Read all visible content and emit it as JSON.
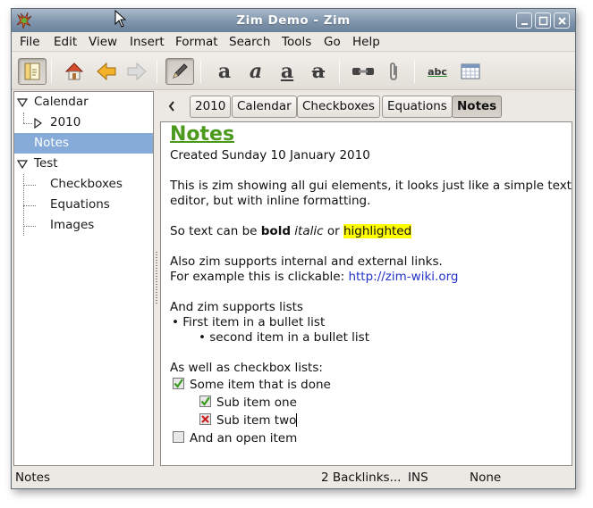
{
  "window": {
    "title": "Zim Demo - Zim",
    "controls": [
      "minimize-icon",
      "maximize-icon",
      "close-icon"
    ]
  },
  "menubar": {
    "items": [
      "File",
      "Edit",
      "View",
      "Insert",
      "Format",
      "Search",
      "Tools",
      "Go",
      "Help"
    ]
  },
  "toolbar": {
    "icons": [
      "index-pane-icon",
      "home-icon",
      "back-arrow-icon",
      "forward-arrow-icon",
      "edit-pencil-icon",
      "bold-icon",
      "italic-icon",
      "underline-icon",
      "strikethrough-icon",
      "insert-link-icon",
      "attach-file-icon",
      "spell-check-icon",
      "calendar-icon"
    ],
    "bold_glyph": "a",
    "italic_glyph": "a",
    "underline_glyph": "a",
    "strike_glyph": "a",
    "spell_glyph": "abc"
  },
  "sidebar": {
    "items": [
      {
        "label": "Calendar",
        "expanded": true,
        "level": 0
      },
      {
        "label": "2010",
        "expanded": false,
        "level": 1
      },
      {
        "label": "Notes",
        "selected": true,
        "level": 0
      },
      {
        "label": "Test",
        "expanded": true,
        "level": 0
      },
      {
        "label": "Checkboxes",
        "level": 1
      },
      {
        "label": "Equations",
        "level": 1
      },
      {
        "label": "Images",
        "level": 1
      }
    ]
  },
  "pathbar": {
    "back_label": "<",
    "items": [
      {
        "label": "2010"
      },
      {
        "label": "Calendar"
      },
      {
        "label": "Checkboxes"
      },
      {
        "label": "Equations"
      },
      {
        "label": "Notes",
        "active": true
      }
    ]
  },
  "page": {
    "heading": "Notes",
    "created": "Created Sunday 10 January 2010",
    "intro_line1": "This is zim showing all gui elements, it looks just like a simple text",
    "intro_line2": "editor, but with inline formatting.",
    "format_prefix": "So text can be ",
    "bold": "bold",
    "italic": "italic",
    "or": " or ",
    "highlighted": "highlighted",
    "links_line1": "Also zim supports internal and external links.",
    "links_line2": "For example this is clickable:  ",
    "link_url": "http://zim-wiki.org",
    "lists_intro": "And zim supports lists",
    "bullet1": "• First item in a bullet list",
    "bullet2": "• second item in a bullet list",
    "checkbox_intro": "As well as checkbox lists:",
    "checkboxes": [
      {
        "label": "Some item that is done",
        "state": "checked"
      },
      {
        "label": "Sub item one",
        "state": "checked"
      },
      {
        "label": "Sub item two",
        "state": "crossed"
      },
      {
        "label": "And an open item",
        "state": "open"
      }
    ],
    "colors": {
      "heading": "#4b9a1d",
      "highlight": "#ffff00",
      "link": "#2232c8"
    }
  },
  "statusbar": {
    "page_name": "Notes",
    "backlinks": "2 Backlinks...",
    "mode": "INS",
    "style": "None"
  }
}
